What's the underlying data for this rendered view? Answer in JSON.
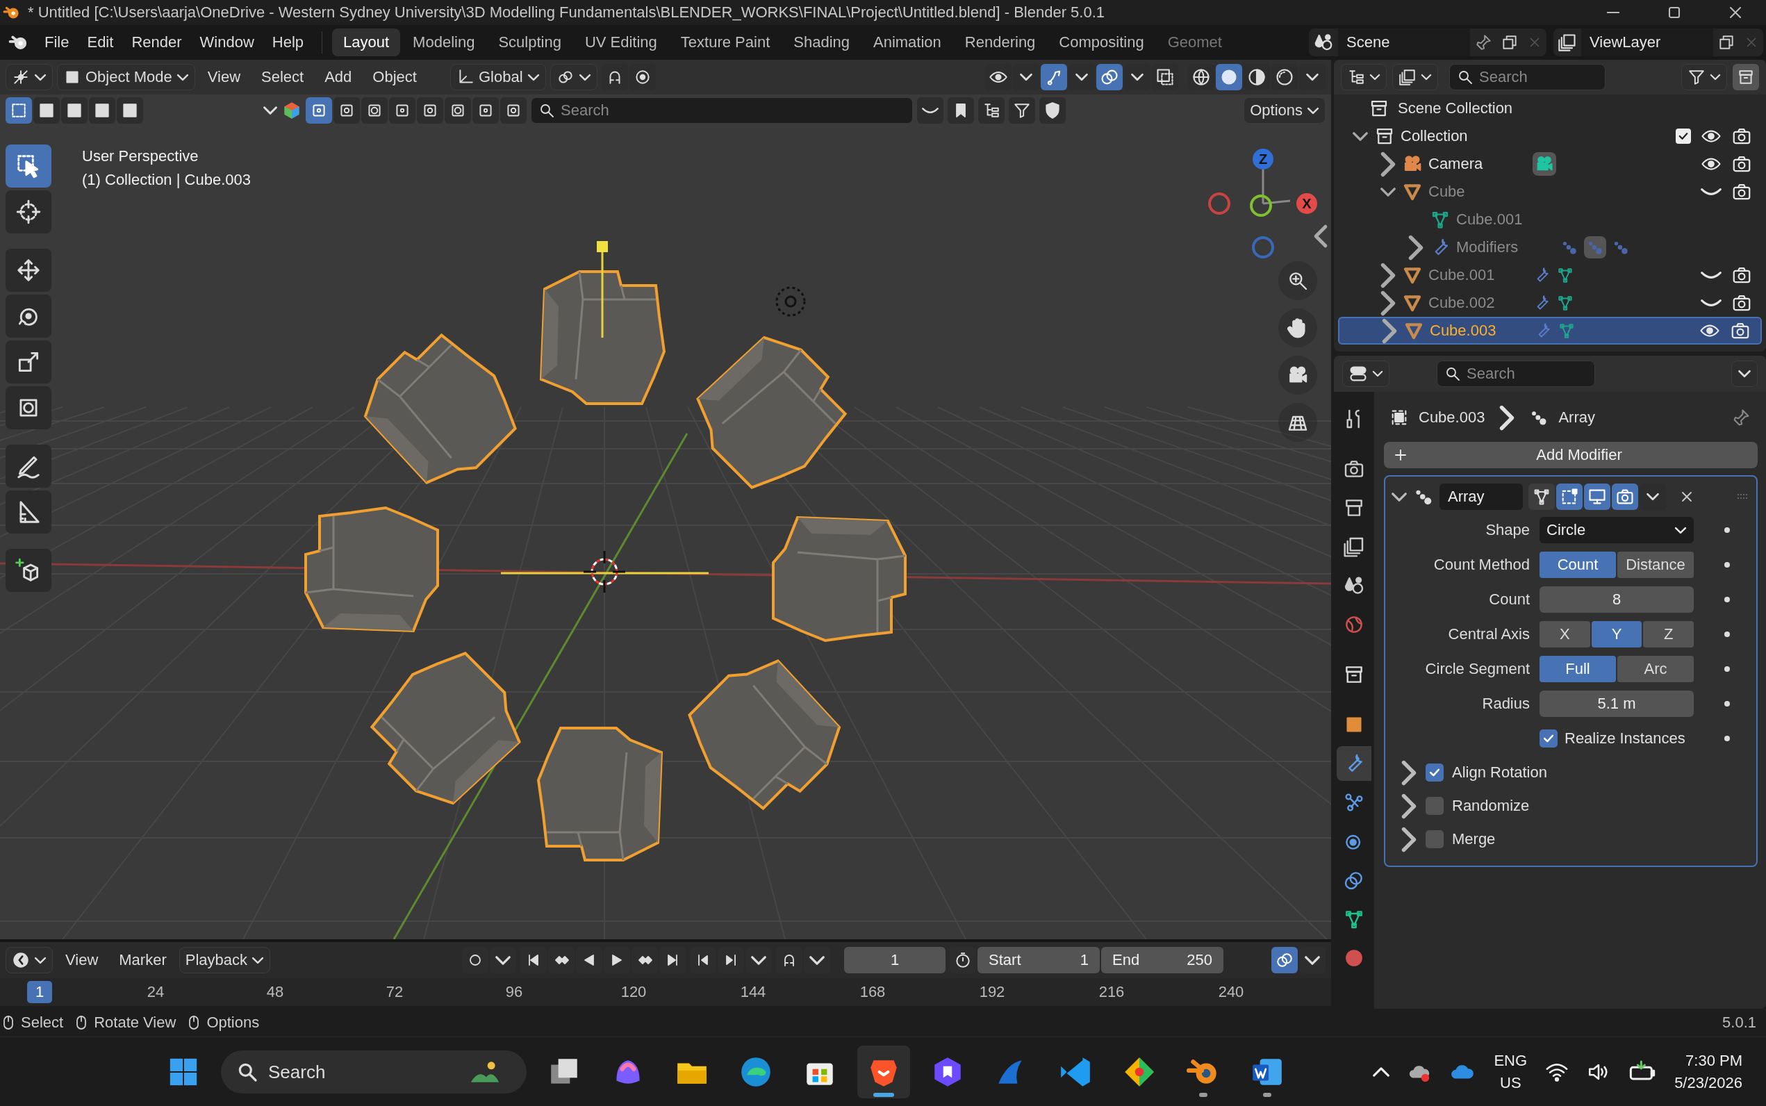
{
  "window": {
    "title": "* Untitled [C:\\Users\\aarja\\OneDrive - Western Sydney University\\3D Modelling Fundamentals\\BLENDER_WORKS\\FINAL\\Project\\Untitled.blend] - Blender 5.0.1"
  },
  "menu": [
    "File",
    "Edit",
    "Render",
    "Window",
    "Help"
  ],
  "workspaces": [
    {
      "label": "Layout",
      "selected": true
    },
    {
      "label": "Modeling",
      "selected": false
    },
    {
      "label": "Sculpting",
      "selected": false
    },
    {
      "label": "UV Editing",
      "selected": false
    },
    {
      "label": "Texture Paint",
      "selected": false
    },
    {
      "label": "Shading",
      "selected": false
    },
    {
      "label": "Animation",
      "selected": false
    },
    {
      "label": "Rendering",
      "selected": false
    },
    {
      "label": "Compositing",
      "selected": false
    },
    {
      "label": "Geomet",
      "selected": false
    }
  ],
  "scene": {
    "name": "Scene"
  },
  "view_layer": {
    "name": "ViewLayer"
  },
  "viewport": {
    "mode": "Object Mode",
    "menu": [
      "View",
      "Select",
      "Add",
      "Object"
    ],
    "orientation": "Global",
    "toggles": [
      {
        "kind": "snap",
        "on": false
      },
      {
        "kind": "proportional",
        "on": false
      }
    ],
    "select_modes": [
      {
        "selected": true
      },
      {
        "selected": false
      },
      {
        "selected": false
      },
      {
        "selected": false
      },
      {
        "selected": false
      }
    ],
    "filters": [
      {
        "selected": true
      },
      {
        "selected": false
      },
      {
        "selected": false
      },
      {
        "selected": false
      },
      {
        "selected": false
      },
      {
        "selected": false
      },
      {
        "selected": false
      },
      {
        "selected": false
      }
    ],
    "search": {
      "placeholder": "Search"
    },
    "view_toggles": [
      {
        "kind": "visibility",
        "on": false
      },
      {
        "kind": "gizmo",
        "on": true
      },
      {
        "kind": "overlay",
        "on": true
      },
      {
        "kind": "xray",
        "on": false
      }
    ],
    "shading": [
      {
        "kind": "wireframe",
        "selected": false
      },
      {
        "kind": "solid",
        "selected": true
      },
      {
        "kind": "material",
        "selected": false
      },
      {
        "kind": "rendered",
        "selected": false
      }
    ],
    "options": "Options",
    "overlay_text": [
      "User Perspective",
      "(1) Collection | Cube.003"
    ],
    "tools": [
      {
        "kind": "select",
        "selected": true
      },
      {
        "kind": "cursor",
        "selected": false
      },
      {
        "kind": "move",
        "selected": false
      },
      {
        "kind": "rotate",
        "selected": false
      },
      {
        "kind": "scale",
        "selected": false
      },
      {
        "kind": "transform",
        "selected": false
      },
      {
        "kind": "annotate",
        "selected": false
      },
      {
        "kind": "measure",
        "selected": false
      },
      {
        "kind": "add_cube",
        "selected": false
      }
    ],
    "gizmo": {
      "z": "Z",
      "x": "X"
    }
  },
  "outliner": {
    "search": {
      "placeholder": "Search"
    },
    "root": "Scene Collection",
    "items": [
      {
        "name": "Collection",
        "kind": "collection",
        "expanded": true,
        "checked": true,
        "visible": true,
        "selected": false,
        "children": [
          {
            "name": "Camera",
            "kind": "camera",
            "expanded": false,
            "visible": true,
            "selected": false
          },
          {
            "name": "Cube",
            "kind": "mesh",
            "expanded": true,
            "visible": false,
            "selected": false,
            "children": [
              {
                "name": "Cube.001",
                "kind": "mesh_data"
              },
              {
                "name": "Modifiers",
                "kind": "modifiers",
                "expanded": false
              }
            ]
          },
          {
            "name": "Cube.001",
            "kind": "mesh",
            "expanded": false,
            "visible": false,
            "selected": false
          },
          {
            "name": "Cube.002",
            "kind": "mesh",
            "expanded": false,
            "visible": false,
            "selected": false
          },
          {
            "name": "Cube.003",
            "kind": "mesh",
            "expanded": false,
            "visible": true,
            "selected": true
          }
        ]
      }
    ]
  },
  "properties": {
    "search": {
      "placeholder": "Search"
    },
    "tabs": [
      {
        "kind": "tool",
        "selected": false
      },
      {
        "kind": "render",
        "selected": false
      },
      {
        "kind": "output",
        "selected": false
      },
      {
        "kind": "view_layer",
        "selected": false
      },
      {
        "kind": "scene",
        "selected": false
      },
      {
        "kind": "world",
        "selected": false
      },
      {
        "kind": "collection",
        "selected": false
      },
      {
        "kind": "object",
        "selected": false
      },
      {
        "kind": "modifier",
        "selected": true
      },
      {
        "kind": "particles",
        "selected": false
      },
      {
        "kind": "physics",
        "selected": false
      },
      {
        "kind": "constraints",
        "selected": false
      },
      {
        "kind": "data",
        "selected": false
      },
      {
        "kind": "material",
        "selected": false
      }
    ],
    "breadcrumb": [
      "Cube.003",
      "Array"
    ],
    "add_modifier": "Add Modifier",
    "modifier": {
      "name": "Array",
      "expanded": true,
      "toggles": [
        {
          "kind": "on_cage",
          "on": false
        },
        {
          "kind": "edit_mode",
          "on": true
        },
        {
          "kind": "viewport",
          "on": true
        },
        {
          "kind": "render",
          "on": true
        }
      ],
      "fields": [
        {
          "kind": "dropdown",
          "label": "Shape",
          "value": "Circle"
        },
        {
          "kind": "toggle",
          "label": "Count Method",
          "options": [
            {
              "label": "Count",
              "selected": true
            },
            {
              "label": "Distance",
              "selected": false
            }
          ]
        },
        {
          "kind": "number",
          "label": "Count",
          "value": "8"
        },
        {
          "kind": "toggle",
          "label": "Central Axis",
          "options": [
            {
              "label": "X",
              "selected": false
            },
            {
              "label": "Y",
              "selected": true
            },
            {
              "label": "Z",
              "selected": false
            }
          ]
        },
        {
          "kind": "toggle",
          "label": "Circle Segment",
          "options": [
            {
              "label": "Full",
              "selected": true
            },
            {
              "label": "Arc",
              "selected": false
            }
          ]
        },
        {
          "kind": "number",
          "label": "Radius",
          "value": "5.1 m"
        },
        {
          "kind": "checkbox",
          "label": "Realize Instances",
          "checked": true
        }
      ],
      "panels": [
        {
          "label": "Align Rotation",
          "checked": true,
          "expanded": false
        },
        {
          "label": "Randomize",
          "checked": false,
          "expanded": false
        },
        {
          "label": "Merge",
          "checked": false,
          "expanded": false
        }
      ]
    }
  },
  "timeline": {
    "menu": [
      "View",
      "Marker",
      "Playback"
    ],
    "current_frame": "1",
    "start_label": "Start",
    "start": "1",
    "end_label": "End",
    "end": "250",
    "playhead": "1",
    "ticks": [
      "24",
      "48",
      "72",
      "96",
      "120",
      "144",
      "168",
      "192",
      "216",
      "240"
    ]
  },
  "status_bar": {
    "hints": [
      "Select",
      "Rotate View",
      "Options"
    ],
    "version": "5.0.1"
  },
  "taskbar": {
    "search": {
      "placeholder": "Search"
    },
    "apps": [
      {
        "kind": "task_view",
        "running": false,
        "selected": false
      },
      {
        "kind": "copilot",
        "running": false,
        "selected": false
      },
      {
        "kind": "file_explorer",
        "running": false,
        "selected": false
      },
      {
        "kind": "edge",
        "running": false,
        "selected": false
      },
      {
        "kind": "store",
        "running": false,
        "selected": false
      },
      {
        "kind": "brave",
        "running": true,
        "selected": true
      },
      {
        "kind": "vpn",
        "running": false,
        "selected": false
      },
      {
        "kind": "wireshark",
        "running": false,
        "selected": false
      },
      {
        "kind": "vscode",
        "running": false,
        "selected": false
      },
      {
        "kind": "git",
        "running": false,
        "selected": false
      },
      {
        "kind": "blender",
        "running": true,
        "selected": false
      },
      {
        "kind": "word",
        "running": true,
        "selected": false
      }
    ],
    "language": "ENG",
    "region": "US",
    "time": "7:30 PM",
    "date": "5/23/2026"
  }
}
